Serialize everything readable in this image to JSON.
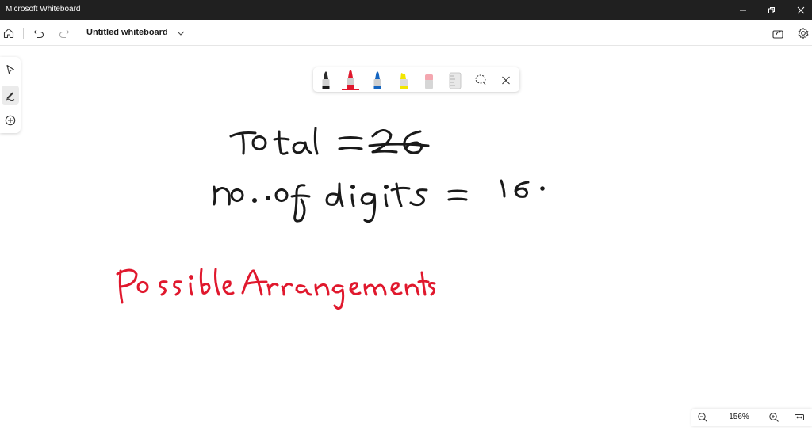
{
  "window": {
    "title": "Microsoft Whiteboard"
  },
  "command_bar": {
    "document_title": "Untitled whiteboard"
  },
  "zoom": {
    "level": "156%"
  },
  "colors": {
    "titlebar": "#202020",
    "black_ink": "#1a1a1a",
    "red_ink": "#e0182d",
    "blue_ink": "#1565c0",
    "yellow_highlighter": "#f2e600"
  },
  "ink_tools": [
    "pen-black",
    "pen-red",
    "pen-blue",
    "highlighter-yellow",
    "eraser",
    "ruler",
    "lasso-select",
    "close"
  ],
  "ink_strokes": {
    "line1": "Total = 26",
    "line2": "no. of digits = 16 .",
    "line3": "Possible Arrangements"
  }
}
